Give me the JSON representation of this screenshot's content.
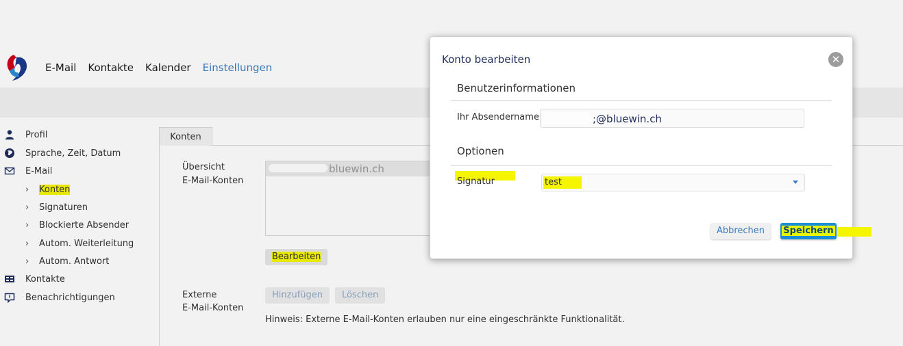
{
  "header": {
    "nav": [
      "E-Mail",
      "Kontakte",
      "Kalender",
      "Einstellungen"
    ],
    "active": "Einstellungen"
  },
  "sidebar": {
    "items": [
      {
        "label": "Profil",
        "icon": "person-icon"
      },
      {
        "label": "Sprache, Zeit, Datum",
        "icon": "globe-icon"
      },
      {
        "label": "E-Mail",
        "icon": "envelope-icon"
      },
      {
        "label": "Konten",
        "sub": true,
        "highlighted": true
      },
      {
        "label": "Signaturen",
        "sub": true
      },
      {
        "label": "Blockierte Absender",
        "sub": true
      },
      {
        "label": "Autom. Weiterleitung",
        "sub": true
      },
      {
        "label": "Autom. Antwort",
        "sub": true
      },
      {
        "label": "Kontakte",
        "icon": "contacts-icon"
      },
      {
        "label": "Benachrichtigungen",
        "icon": "notification-icon"
      }
    ]
  },
  "content": {
    "tab": "Konten",
    "overview_label_1": "Übersicht",
    "overview_label_2": "E-Mail-Konten",
    "account_entry": "bluewin.ch",
    "edit_button": "Bearbeiten",
    "external_label_1": "Externe",
    "external_label_2": "E-Mail-Konten",
    "add_button": "Hinzufügen",
    "delete_button": "Löschen",
    "hint": "Hinweis: Externe E-Mail-Konten erlauben nur eine eingeschränkte Funktionalität."
  },
  "dialog": {
    "title": "Konto bearbeiten",
    "close_glyph": "✕",
    "section_user": "Benutzerinformationen",
    "sender_label": "Ihr Absendername",
    "sender_value": ";@bluewin.ch",
    "section_options": "Optionen",
    "signature_label": "Signatur",
    "signature_value": "test",
    "cancel_button": "Abbrechen",
    "save_button": "Speichern"
  },
  "colors": {
    "accent": "#3a7cc0",
    "highlight": "#f5f500",
    "save_button": "#1a8fd8"
  }
}
